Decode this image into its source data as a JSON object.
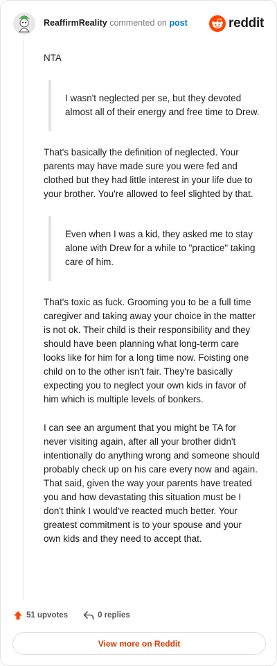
{
  "header": {
    "username": "ReaffirmReality",
    "verb": "commented on",
    "post_link": "post",
    "brand": "reddit"
  },
  "comment": {
    "p1": "NTA",
    "quote1": "I wasn't neglected per se, but they devoted almost all of their energy and free time to Drew.",
    "p2": "That's basically the definition of neglected. Your parents may have made sure you were fed and clothed but they had little interest in your life due to your brother. You're allowed to feel slighted by that.",
    "quote2": "Even when I was a kid, they asked me to stay alone with Drew for a while to \"practice\" taking care of him.",
    "p3": "That's toxic as fuck. Grooming you to be a full time caregiver and taking away your choice in the matter is not ok. Their child is their responsibility and they should have been planning what long-term care looks like for him for a long time now. Foisting one child on to the other isn't fair. They're basically expecting you to neglect your own kids in favor of him which is multiple levels of bonkers.",
    "p4": "I can see an argument that you might be TA for never visiting again, after all your brother didn't intentionally do anything wrong and someone should probably check up on his care every now and again. That said, given the way your parents have treated you and how devastating this situation must be I don't think I would've reacted much better. Your greatest commitment is to your spouse and your own kids and they need to accept that."
  },
  "actions": {
    "upvotes": "51 upvotes",
    "replies": "0 replies"
  },
  "footer": {
    "view_button": "View more on Reddit"
  },
  "colors": {
    "brand_orange": "#ff4500",
    "link_blue": "#0079d3",
    "button_text": "#d93a00"
  },
  "icons": [
    "avatar",
    "reddit-logo-icon",
    "upvote-arrow-icon",
    "reply-icon"
  ]
}
